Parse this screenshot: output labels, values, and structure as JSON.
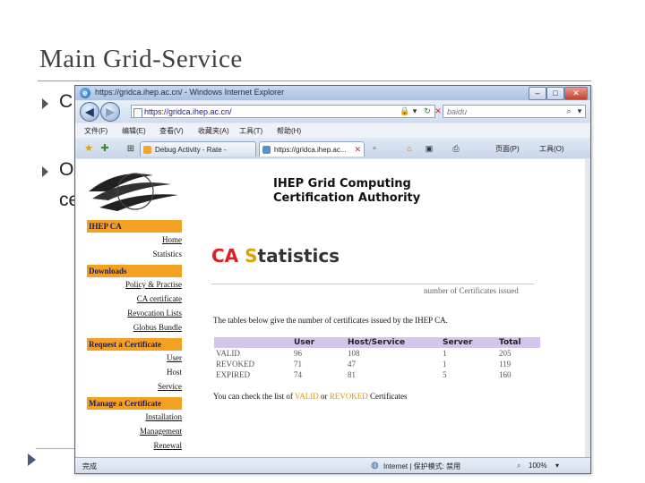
{
  "slide": {
    "title": "Main Grid-Service",
    "bullets": [
      "C",
      "O",
      "ce"
    ]
  },
  "browser": {
    "window_title": "https://gridca.ihep.ac.cn/ - Windows Internet Explorer",
    "address": "https://gridca.ihep.ac.cn/",
    "search_placeholder": "baidu",
    "menu": [
      "文件(F)",
      "编辑(E)",
      "查看(V)",
      "收藏夹(A)",
      "工具(T)",
      "帮助(H)"
    ],
    "tabs": [
      {
        "label": "Debug Activity - Rate -"
      },
      {
        "label": "https://gridca.ihep.ac..."
      }
    ],
    "command_bar": [
      "页面(P)",
      "工具(O)"
    ],
    "status": {
      "left": "完成",
      "zone": "Internet | 保护模式: 禁用",
      "zoom": "100%"
    }
  },
  "page": {
    "site_title_line1": "IHEP Grid Computing",
    "site_title_line2": "Certification Authority",
    "nav": {
      "section1": "IHEP CA",
      "home": "Home",
      "statistics": "Statistics",
      "section2": "Downloads",
      "policy": "Policy & Practise",
      "ca_cert": "CA certificate",
      "revocation": "Revocation Lists",
      "globus": "Globus Bundle",
      "section3": "Request a Certificate",
      "user": "User",
      "host": "Host",
      "service": "Service",
      "section4": "Manage a Certificate",
      "installation": "Installation",
      "management": "Management",
      "renewal": "Renewal"
    },
    "heading_ca": "CA",
    "heading_s": "S",
    "heading_rest": "tatistics",
    "subheading": "number of Certificates issued",
    "intro": "The tables below give the number of certificates issued by the IHEP CA.",
    "table": {
      "headers": [
        "",
        "User",
        "Host/Service",
        "Server",
        "Total"
      ],
      "rows": [
        [
          "VALID",
          "96",
          "108",
          "1",
          "205"
        ],
        [
          "REVOKED",
          "71",
          "47",
          "1",
          "119"
        ],
        [
          "EXPIRED",
          "74",
          "81",
          "5",
          "160"
        ]
      ]
    },
    "check_prefix": "You can check the list of ",
    "check_valid": "VALID",
    "check_or": " or ",
    "check_revoked": "REVOKED",
    "check_suffix": " Certificates"
  },
  "colors": {
    "nav_header": "#f4a023",
    "table_header": "#d7c4ea",
    "heading_red": "#e02020",
    "heading_orange": "#e0a000"
  }
}
